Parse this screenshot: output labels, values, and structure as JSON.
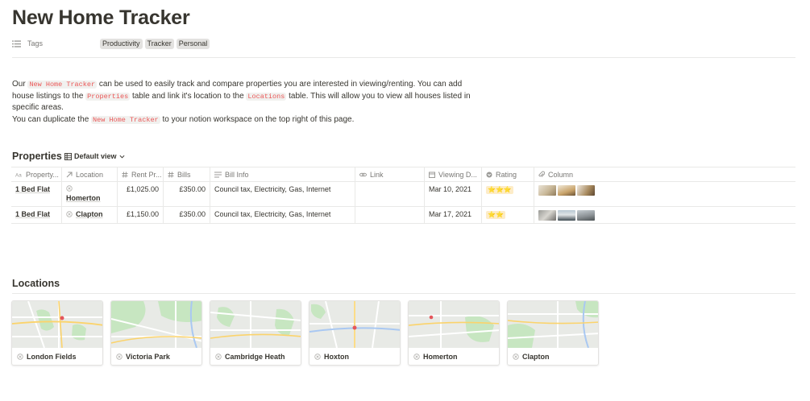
{
  "page": {
    "title": "New Home Tracker",
    "property_label": "Tags",
    "tags": [
      "Productivity",
      "Tracker",
      "Personal"
    ]
  },
  "intro": {
    "p1_a": "Our",
    "p1_code1": "New Home Tracker",
    "p1_b": "can be used to easily track and compare properties you are interested in viewing/renting. You can add house listings to the",
    "p1_code2": "Properties",
    "p1_c": "table and link it's location to the",
    "p1_code3": "Locations",
    "p1_d": "table. This will allow you to view all houses listed in specific areas.",
    "p2_a": "You can duplicate the",
    "p2_code": "New Home Tracker",
    "p2_b": "to your notion workspace on the top right of this page."
  },
  "properties": {
    "title": "Properties",
    "view_label": "Default view",
    "columns": [
      "Property...",
      "Location",
      "Rent Pr...",
      "Bills",
      "Bill Info",
      "Link",
      "Viewing D...",
      "Rating",
      "Column"
    ],
    "rows": [
      {
        "name": "1 Bed Flat",
        "location": "Homerton",
        "rent": "£1,025.00",
        "bills": "£350.00",
        "bill_info": "Council tax, Electricity, Gas, Internet",
        "link": "",
        "viewing_date": "Mar 10, 2021",
        "rating": "⭐⭐⭐"
      },
      {
        "name": "1 Bed Flat",
        "location": "Clapton",
        "rent": "£1,150.00",
        "bills": "£350.00",
        "bill_info": "Council tax, Electricity, Gas, Internet",
        "link": "",
        "viewing_date": "Mar 17, 2021",
        "rating": "⭐⭐"
      }
    ]
  },
  "locations": {
    "title": "Locations",
    "cards": [
      "London Fields",
      "Victoria Park",
      "Cambridge Heath",
      "Hoxton",
      "Homerton",
      "Clapton"
    ]
  },
  "colors": {
    "code_text": "#eb5757",
    "tag_bg": "#e3e2e0",
    "rating_bg": "#fdecc8",
    "map_base": "#e8eae6",
    "map_park": "#c7e6c1",
    "map_road": "#fbd36b"
  },
  "icons": {
    "tags": "list-icon",
    "view": "table-icon",
    "location_page": "page-dot-icon"
  }
}
